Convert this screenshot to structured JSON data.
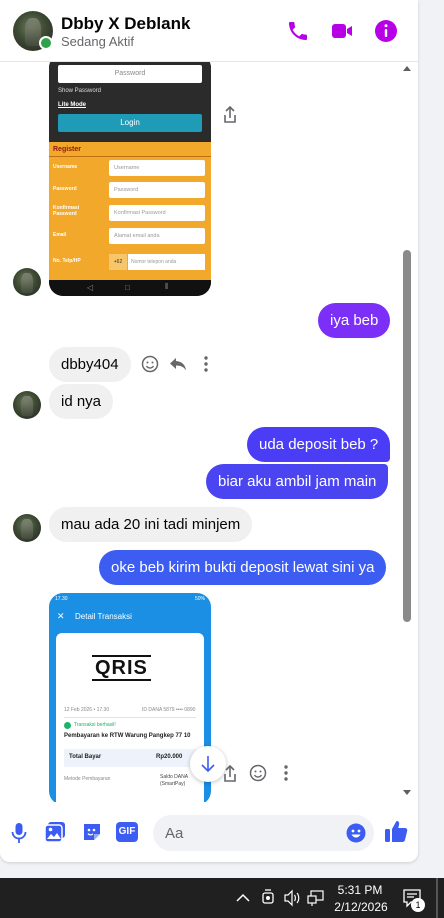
{
  "header": {
    "name": "Dbby X Deblank",
    "status": "Sedang Aktif",
    "accent": "#b800e6"
  },
  "messages": [
    {
      "id": "m1",
      "side": "out",
      "text": "iya beb",
      "color": "#7b2ff7"
    },
    {
      "id": "m2",
      "side": "in",
      "text": "dbby404"
    },
    {
      "id": "m3",
      "side": "in",
      "text": "id nya"
    },
    {
      "id": "m4",
      "side": "out",
      "text": "uda deposit beb ?",
      "color": "#4b3cf5"
    },
    {
      "id": "m5",
      "side": "out",
      "text": "biar aku ambil jam main",
      "color": "#4a45f0"
    },
    {
      "id": "m6",
      "side": "in",
      "text": "mau ada 20 ini tadi minjem"
    },
    {
      "id": "m7",
      "side": "out",
      "text": "oke beb kirim bukti deposit lewat sini ya",
      "color": "#3d5cf2"
    }
  ],
  "shot1": {
    "password_placeholder": "Password",
    "show_password": "Show Password",
    "lite_mode": "Lite Mode",
    "login": "Login",
    "register": "Register",
    "fields": [
      {
        "label": "Username",
        "placeholder": "Username"
      },
      {
        "label": "Password",
        "placeholder": "Password"
      },
      {
        "label": "Konfirmasi Password",
        "placeholder": "Konfirmasi Password"
      },
      {
        "label": "Email",
        "placeholder": "Alamat email anda"
      },
      {
        "label": "No. Telp/HP",
        "prefix": "+62",
        "placeholder": "Nomor telepon anda"
      }
    ]
  },
  "shot2": {
    "status_time": "17.30",
    "status_right": "50%",
    "title": "Detail Transaksi",
    "logo": "QRIS",
    "date": "12 Feb 2026 • 17.30",
    "ref": "ID DANA 5879 •••• 0890",
    "success": "Transaksi berhasil!",
    "desc": "Pembayaran ke RTW Warung Pangkep 77 10",
    "total_label": "Total Bayar",
    "total_value": "Rp20.000",
    "method_label": "Metode Pembayaran",
    "method_value": "Saldo DANA",
    "method_sub": "(SmartPay)"
  },
  "composer": {
    "placeholder": "Aa"
  },
  "taskbar": {
    "time": "5:31 PM",
    "date": "2/12/2026",
    "notif_count": "1"
  }
}
